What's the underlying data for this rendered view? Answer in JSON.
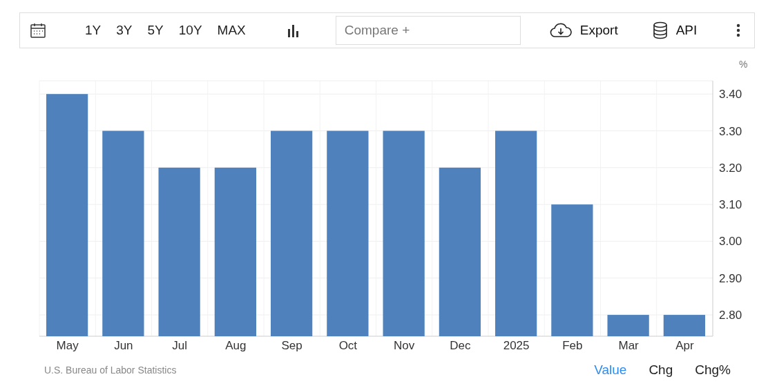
{
  "toolbar": {
    "ranges": [
      {
        "label": "1Y",
        "selected": false
      },
      {
        "label": "3Y",
        "selected": false
      },
      {
        "label": "5Y",
        "selected": false
      },
      {
        "label": "10Y",
        "selected": false
      },
      {
        "label": "MAX",
        "selected": false
      }
    ],
    "compare": {
      "placeholder": "Compare +"
    },
    "export": "Export",
    "api": "API"
  },
  "chart": {
    "unit": "%",
    "chart_data": {
      "type": "bar",
      "categories": [
        "May",
        "Jun",
        "Jul",
        "Aug",
        "Sep",
        "Oct",
        "Nov",
        "Dec",
        "2025",
        "Feb",
        "Mar",
        "Apr"
      ],
      "grid": true,
      "series": [
        {
          "color": "#4f81bd",
          "values": [
            3.4,
            3.3,
            3.2,
            3.2,
            3.3,
            3.3,
            3.3,
            3.2,
            3.3,
            3.1,
            2.8,
            2.8
          ]
        }
      ],
      "ylim": [
        2.742,
        3.436
      ],
      "yticks": [
        {
          "value": 2.8,
          "label": "2.80"
        },
        {
          "value": 2.9,
          "label": "2.90"
        },
        {
          "value": 3.0,
          "label": "3.00"
        },
        {
          "value": 3.1,
          "label": "3.10"
        },
        {
          "value": 3.2,
          "label": "3.20"
        },
        {
          "value": 3.3,
          "label": "3.30"
        },
        {
          "value": 3.4,
          "label": "3.40"
        }
      ]
    }
  },
  "footer": {
    "source": "U.S. Bureau of Labor Statistics",
    "views": [
      {
        "label": "Value",
        "selected": true
      },
      {
        "label": "Chg",
        "selected": false
      },
      {
        "label": "Chg%",
        "selected": false
      }
    ]
  }
}
